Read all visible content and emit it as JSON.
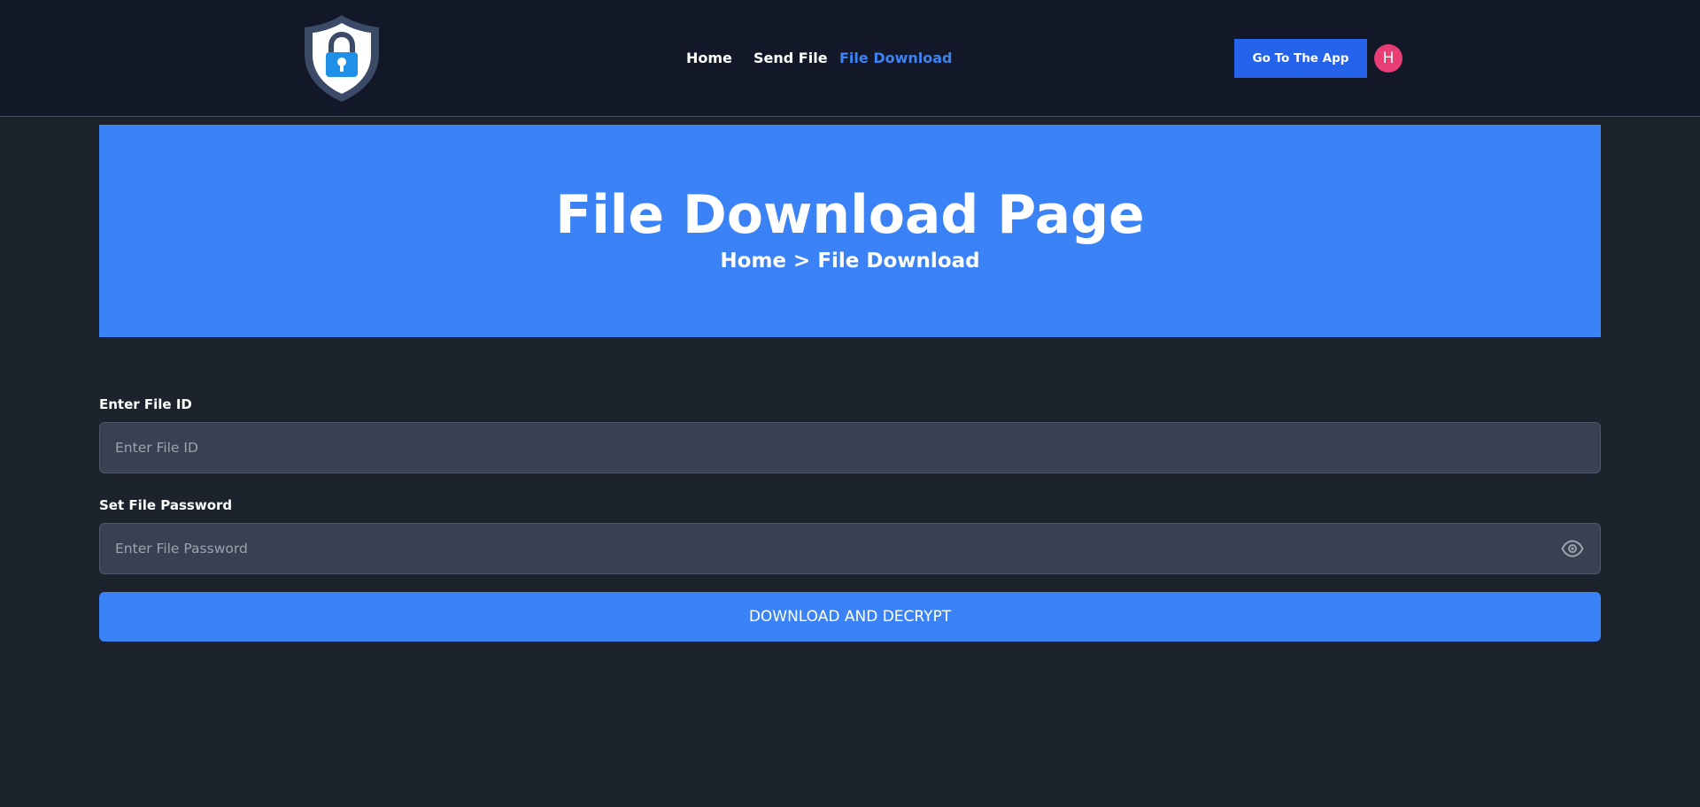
{
  "header": {
    "logo_icon": "shield-lock-icon",
    "nav": [
      {
        "label": "Home",
        "active": false
      },
      {
        "label": "Send File",
        "active": false
      },
      {
        "label": "File Download",
        "active": true
      }
    ],
    "cta_label": "Go To The App",
    "avatar_initial": "H"
  },
  "hero": {
    "title": "File Download Page",
    "breadcrumb": {
      "home": "Home",
      "separator": ">",
      "current": "File Download"
    }
  },
  "form": {
    "file_id": {
      "label": "Enter File ID",
      "placeholder": "Enter File ID",
      "value": ""
    },
    "password": {
      "label": "Set File Password",
      "placeholder": "Enter File Password",
      "value": "",
      "toggle_icon": "eye-icon"
    },
    "submit_label": "DOWNLOAD AND DECRYPT"
  },
  "colors": {
    "page_bg": "#1d232d",
    "navbar_bg": "#121828",
    "accent": "#3b82f6",
    "cta_bg": "#2563eb",
    "input_bg": "#374152",
    "avatar_bg": "#e83e75"
  }
}
